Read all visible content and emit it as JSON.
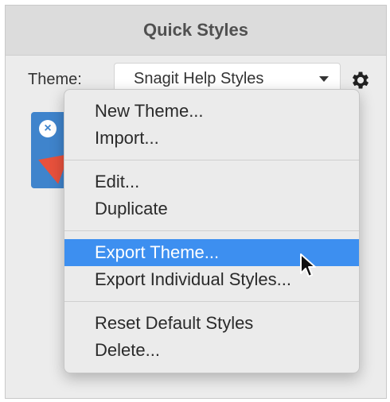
{
  "panel": {
    "title": "Quick Styles",
    "theme_label": "Theme:",
    "theme_value": "Snagit Help Styles",
    "gear_icon": "gear-icon"
  },
  "thumbnail": {
    "color": "#3f84cc",
    "arrow_color": "#e8513c"
  },
  "menu": {
    "groups": [
      [
        "New Theme...",
        "Import..."
      ],
      [
        "Edit...",
        "Duplicate"
      ],
      [
        "Export Theme...",
        "Export Individual Styles..."
      ],
      [
        "Reset Default Styles",
        "Delete..."
      ]
    ],
    "highlighted": "Export Theme...",
    "highlight_color": "#3d8ff0"
  }
}
